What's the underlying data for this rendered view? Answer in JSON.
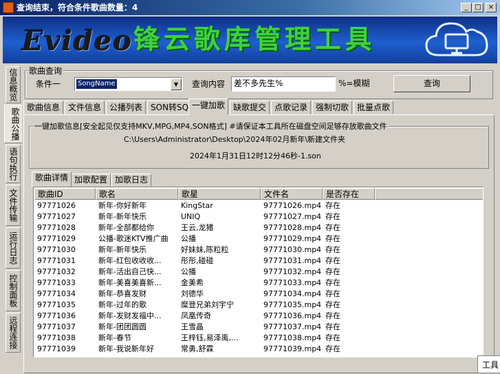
{
  "window": {
    "title": "查询结束，符合条件歌曲数量：4",
    "controls": [
      "_",
      "□",
      "×"
    ]
  },
  "banner": {
    "logo": "Evideo",
    "title": "锋云歌库管理工具",
    "icon": "cloud-monitor-icon"
  },
  "side_tabs": [
    "信息概览",
    "歌曲公播",
    "语句执行",
    "文件传输",
    "运行日志",
    "控制面板",
    "远程连接"
  ],
  "query": {
    "group_label": "歌曲查询",
    "condition_label": "条件一",
    "condition_value": "SongName",
    "content_label": "查询内容",
    "content_value": "差不多先生%",
    "fuzzy_hint": "%=模糊",
    "query_button": "查询"
  },
  "main_tabs": [
    "歌曲信息",
    "文件信息",
    "公播列表",
    "SON转SQL",
    "一键加歌",
    "缺歌提交",
    "点歌记录",
    "强制切歌",
    "批量点歌"
  ],
  "active_main_tab": 4,
  "add_info": {
    "group_label": "一键加歌信息[安全起见仅支持MKV,MPG,MP4,SON格式] #请保证本工具所在磁盘空间足够存放歌曲文件",
    "path": "C:\\Users\\Administrator\\Desktop\\2024年02月新年\\新建文件夹",
    "son_file": "2024年1月31日12时12分46秒-1.son"
  },
  "sub_tabs": [
    "歌曲详情",
    "加歌配置",
    "加歌日志"
  ],
  "active_sub_tab": 0,
  "table": {
    "columns": [
      "歌曲ID",
      "歌名",
      "歌星",
      "文件名",
      "是否存在"
    ],
    "rows": [
      [
        "97771026",
        "新年-你好新年",
        "KingStar",
        "97771026.mp4",
        "存在"
      ],
      [
        "97771027",
        "新年-新年快乐",
        "UNIQ",
        "97771027.mp4",
        "存在"
      ],
      [
        "97771028",
        "新年-全部都给你",
        "王云,龙猪",
        "97771028.mp4",
        "存在"
      ],
      [
        "97771029",
        "公播-歌迷KTV推广曲",
        "公播",
        "97771029.mp4",
        "存在"
      ],
      [
        "97771030",
        "新年-新年快乐",
        "好妹妹,陈粒粒",
        "97771030.mp4",
        "存在"
      ],
      [
        "97771031",
        "新年-红包收收收...",
        "彤彤,碰碰",
        "97771031.mp4",
        "存在"
      ],
      [
        "97771032",
        "新年-活出自己快...",
        "公播",
        "97771032.mp4",
        "存在"
      ],
      [
        "97771033",
        "新年-美喜美喜新...",
        "金美希",
        "97771033.mp4",
        "存在"
      ],
      [
        "97771034",
        "新年-恭喜发财",
        "刘德华",
        "97771034.mp4",
        "存在"
      ],
      [
        "97771035",
        "新年-过年的歌",
        "糜登兄弟刘宇宁",
        "97771035.mp4",
        "存在"
      ],
      [
        "97771036",
        "新年-发财发福中...",
        "凤凰传奇",
        "97771036.mp4",
        "存在"
      ],
      [
        "97771037",
        "新年-团团圆圆",
        "王雪晶",
        "97771037.mp4",
        "存在"
      ],
      [
        "97771038",
        "新年-春节",
        "王梓钰,易泽禹,...",
        "97771038.mp4",
        "存在"
      ],
      [
        "97771039",
        "新年-我说新年好",
        "常勇,舒霖",
        "97771039.mp4",
        "存在"
      ]
    ]
  },
  "tooltip": "工具"
}
